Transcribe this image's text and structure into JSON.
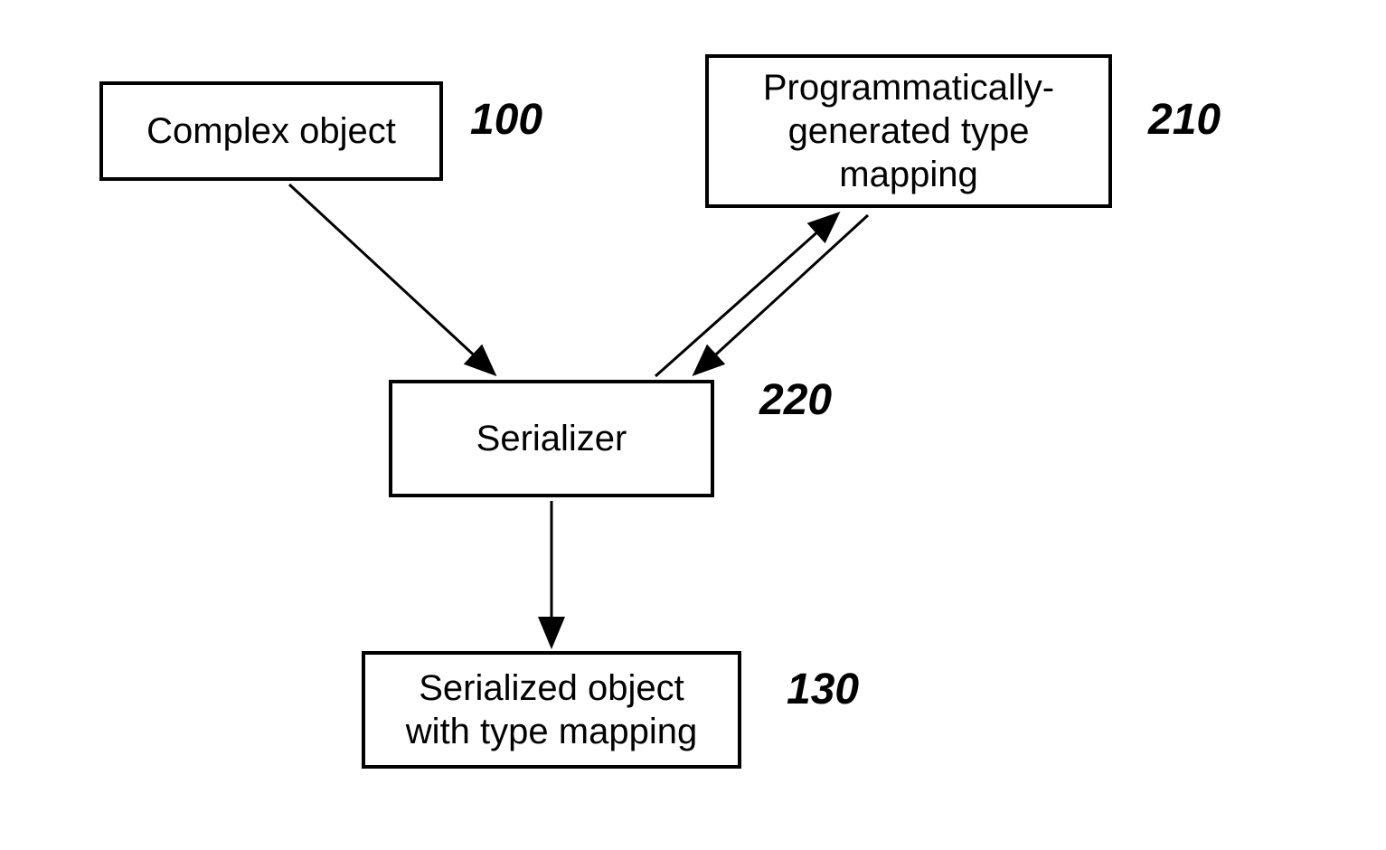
{
  "nodes": {
    "complex_object": {
      "text": "Complex object",
      "ref": "100"
    },
    "type_mapping": {
      "text": "Programmatically-generated type mapping",
      "ref": "210"
    },
    "serializer": {
      "text": "Serializer",
      "ref": "220"
    },
    "output": {
      "text": "Serialized object with type mapping",
      "ref": "130"
    }
  },
  "edges": [
    {
      "from": "complex_object",
      "to": "serializer",
      "bidirectional": false
    },
    {
      "from": "type_mapping",
      "to": "serializer",
      "bidirectional": true
    },
    {
      "from": "serializer",
      "to": "output",
      "bidirectional": false
    }
  ]
}
